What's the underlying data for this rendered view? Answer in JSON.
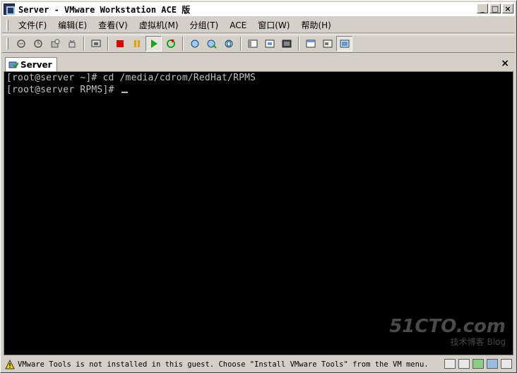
{
  "window": {
    "title": "Server - VMware Workstation ACE 版",
    "controls": {
      "minimize": "_",
      "maximize": "□",
      "close": "×"
    }
  },
  "menu": {
    "items": [
      "文件(F)",
      "编辑(E)",
      "查看(V)",
      "虚拟机(M)",
      "分组(T)",
      "ACE",
      "窗口(W)",
      "帮助(H)"
    ]
  },
  "toolbar": {
    "groups": [
      [
        "snapshot-icon",
        "revert-icon",
        "manage-snapshots-icon",
        "clone-icon"
      ],
      [
        "screenshot-icon"
      ],
      [
        "power-off-icon",
        "suspend-icon",
        "power-on-icon",
        "reset-icon"
      ],
      [
        "team-icon",
        "vm-settings-icon",
        "vm-properties-icon"
      ],
      [
        "sidebar-icon",
        "fit-window-icon",
        "fullscreen-icon"
      ],
      [
        "quick-switch-icon",
        "console-view-icon",
        "summary-view-icon"
      ]
    ],
    "colors": {
      "stop": "#d40000",
      "pause": "#e0a000",
      "play": "#1aa01a"
    }
  },
  "tab": {
    "label": "Server",
    "close": "×"
  },
  "terminal": {
    "lines": [
      "[root@server ~]# cd /media/cdrom/RedHat/RPMS",
      "[root@server RPMS]#"
    ],
    "foreground": "#c0c0c0",
    "background": "#000000"
  },
  "watermark": {
    "brand": "51CTO.com",
    "sub": "技术博客  Blog"
  },
  "status": {
    "message": "VMware Tools is not installed in this guest. Choose \"Install VMware Tools\" from the VM menu."
  }
}
